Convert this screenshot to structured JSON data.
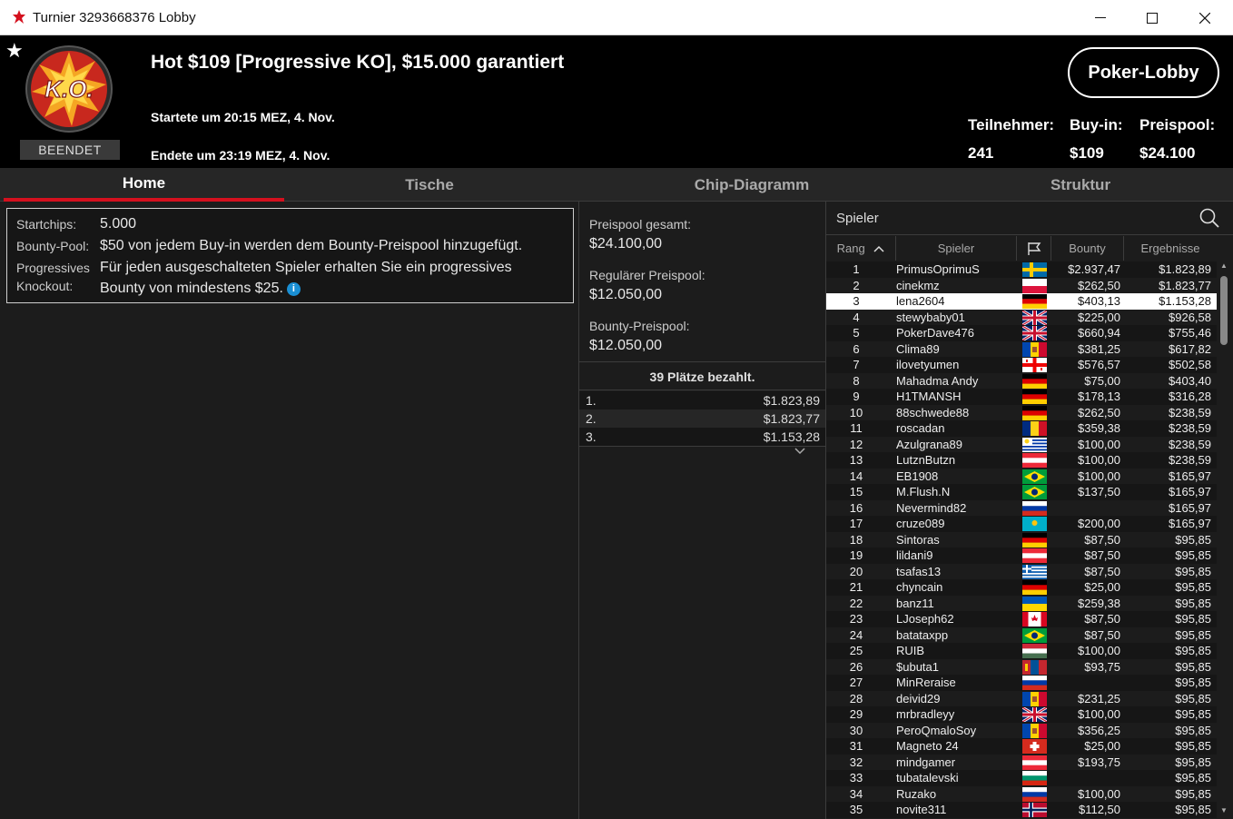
{
  "window": {
    "title": "Turnier 3293668376 Lobby"
  },
  "header": {
    "tournament_name": "Hot $109 [Progressive KO], $15.000 garantiert",
    "status": "BEENDET",
    "started": "Startete um 20:15 MEZ, 4. Nov.",
    "ended": "Endete um 23:19 MEZ, 4. Nov.",
    "lobby_button": "Poker-Lobby",
    "logo_text": "K.O.",
    "stats": {
      "players_label": "Teilnehmer:",
      "players_value": "241",
      "buyin_label": "Buy-in:",
      "buyin_value": "$109",
      "prizepool_label": "Preispool:",
      "prizepool_value": "$24.100"
    }
  },
  "tabs": [
    {
      "label": "Home",
      "active": true
    },
    {
      "label": "Tische",
      "active": false
    },
    {
      "label": "Chip-Diagramm",
      "active": false
    },
    {
      "label": "Struktur",
      "active": false
    }
  ],
  "info": {
    "startchips_label": "Startchips:",
    "startchips_value": "5.000",
    "bounty_label": "Bounty-Pool:",
    "bounty_value": "$50 von jedem Buy-in werden dem Bounty-Preispool hinzugefügt.",
    "pko_label_1": "Progressives",
    "pko_label_2": "Knockout:",
    "pko_value_1": "Für jeden ausgeschalteten Spieler erhalten Sie ein progressives",
    "pko_value_2": "Bounty von mindestens $25."
  },
  "prizepool": {
    "total_label": "Preispool gesamt:",
    "total_value": "$24.100,00",
    "regular_label": "Regulärer Preispool:",
    "regular_value": "$12.050,00",
    "bounty_label": "Bounty-Preispool:",
    "bounty_value": "$12.050,00",
    "paid_places": "39 Plätze bezahlt.",
    "payouts": [
      {
        "rank": "1.",
        "amount": "$1.823,89"
      },
      {
        "rank": "2.",
        "amount": "$1.823,77"
      },
      {
        "rank": "3.",
        "amount": "$1.153,28"
      }
    ]
  },
  "players": {
    "title": "Spieler",
    "columns": {
      "rank": "Rang",
      "name": "Spieler",
      "bounty": "Bounty",
      "result": "Ergebnisse"
    },
    "highlight_color": "#ffffff",
    "rows": [
      {
        "rank": "1",
        "name": "PrimusOprimuS",
        "flag": "se",
        "bounty": "$2.937,47",
        "result": "$1.823,89"
      },
      {
        "rank": "2",
        "name": "cinekmz",
        "flag": "pl",
        "bounty": "$262,50",
        "result": "$1.823,77"
      },
      {
        "rank": "3",
        "name": "lena2604",
        "flag": "de",
        "bounty": "$403,13",
        "result": "$1.153,28",
        "highlight": true
      },
      {
        "rank": "4",
        "name": "stewybaby01",
        "flag": "gb",
        "bounty": "$225,00",
        "result": "$926,58"
      },
      {
        "rank": "5",
        "name": "PokerDave476",
        "flag": "gb",
        "bounty": "$660,94",
        "result": "$755,46"
      },
      {
        "rank": "6",
        "name": "Clima89",
        "flag": "md",
        "bounty": "$381,25",
        "result": "$617,82"
      },
      {
        "rank": "7",
        "name": "ilovetyumen",
        "flag": "ge",
        "bounty": "$576,57",
        "result": "$502,58"
      },
      {
        "rank": "8",
        "name": "Mahadma Andy",
        "flag": "de",
        "bounty": "$75,00",
        "result": "$403,40"
      },
      {
        "rank": "9",
        "name": "H1TMANSH",
        "flag": "de",
        "bounty": "$178,13",
        "result": "$316,28"
      },
      {
        "rank": "10",
        "name": "88schwede88",
        "flag": "de",
        "bounty": "$262,50",
        "result": "$238,59"
      },
      {
        "rank": "11",
        "name": "roscadan",
        "flag": "ro",
        "bounty": "$359,38",
        "result": "$238,59"
      },
      {
        "rank": "12",
        "name": "Azulgrana89",
        "flag": "uy",
        "bounty": "$100,00",
        "result": "$238,59"
      },
      {
        "rank": "13",
        "name": "LutznButzn",
        "flag": "at",
        "bounty": "$100,00",
        "result": "$238,59"
      },
      {
        "rank": "14",
        "name": "EB1908",
        "flag": "br",
        "bounty": "$100,00",
        "result": "$165,97"
      },
      {
        "rank": "15",
        "name": "M.Flush.N",
        "flag": "br",
        "bounty": "$137,50",
        "result": "$165,97"
      },
      {
        "rank": "16",
        "name": "Nevermind82",
        "flag": "ru",
        "bounty": "",
        "result": "$165,97"
      },
      {
        "rank": "17",
        "name": "cruze089",
        "flag": "kz",
        "bounty": "$200,00",
        "result": "$165,97"
      },
      {
        "rank": "18",
        "name": "Sintoras",
        "flag": "de",
        "bounty": "$87,50",
        "result": "$95,85"
      },
      {
        "rank": "19",
        "name": "lildani9",
        "flag": "at",
        "bounty": "$87,50",
        "result": "$95,85"
      },
      {
        "rank": "20",
        "name": "tsafas13",
        "flag": "gr",
        "bounty": "$87,50",
        "result": "$95,85"
      },
      {
        "rank": "21",
        "name": "chyncain",
        "flag": "de",
        "bounty": "$25,00",
        "result": "$95,85"
      },
      {
        "rank": "22",
        "name": "banz11",
        "flag": "ua",
        "bounty": "$259,38",
        "result": "$95,85"
      },
      {
        "rank": "23",
        "name": "LJoseph62",
        "flag": "ca",
        "bounty": "$87,50",
        "result": "$95,85"
      },
      {
        "rank": "24",
        "name": "batataxpp",
        "flag": "br",
        "bounty": "$87,50",
        "result": "$95,85"
      },
      {
        "rank": "25",
        "name": "RUIB",
        "flag": "hu",
        "bounty": "$100,00",
        "result": "$95,85"
      },
      {
        "rank": "26",
        "name": "$ubuta1",
        "flag": "mn",
        "bounty": "$93,75",
        "result": "$95,85"
      },
      {
        "rank": "27",
        "name": "MinReraise",
        "flag": "ru",
        "bounty": "",
        "result": "$95,85"
      },
      {
        "rank": "28",
        "name": "deivid29",
        "flag": "md",
        "bounty": "$231,25",
        "result": "$95,85"
      },
      {
        "rank": "29",
        "name": "mrbradleyy",
        "flag": "gb",
        "bounty": "$100,00",
        "result": "$95,85"
      },
      {
        "rank": "30",
        "name": "PeroQmaloSoy",
        "flag": "md",
        "bounty": "$356,25",
        "result": "$95,85"
      },
      {
        "rank": "31",
        "name": "Magneto 24",
        "flag": "ch",
        "bounty": "$25,00",
        "result": "$95,85"
      },
      {
        "rank": "32",
        "name": "mindgamer",
        "flag": "at",
        "bounty": "$193,75",
        "result": "$95,85"
      },
      {
        "rank": "33",
        "name": "tubatalevski",
        "flag": "bg",
        "bounty": "",
        "result": "$95,85"
      },
      {
        "rank": "34",
        "name": "Ruzako",
        "flag": "ru",
        "bounty": "$100,00",
        "result": "$95,85"
      },
      {
        "rank": "35",
        "name": "novite311",
        "flag": "no",
        "bounty": "$112,50",
        "result": "$95,85"
      }
    ]
  },
  "colors": {
    "accent": "#d4101e",
    "panel": "#1c1c1c",
    "header": "#000000"
  }
}
